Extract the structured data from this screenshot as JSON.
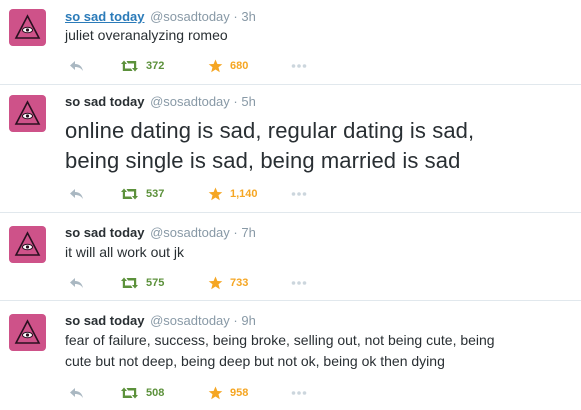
{
  "colors": {
    "name_link": "#2b7bb9",
    "muted": "#8899a6",
    "retweet_green": "#5c913b",
    "favorite_gold": "#f5a623",
    "divider": "#e1e8ed",
    "avatar_pink": "#d6588f"
  },
  "icons": {
    "reply": "reply-arrow-icon",
    "retweet": "retweet-icon",
    "favorite": "star-icon",
    "more": "ellipsis-icon",
    "avatar": "eye-in-triangle-icon"
  },
  "tweets": [
    {
      "name": "so sad today",
      "handle": "@sosadtoday",
      "dot": "·",
      "time": "3h",
      "text": "juliet overanalyzing romeo",
      "retweets": "372",
      "favorites": "680"
    },
    {
      "name": "so sad today",
      "handle": "@sosadtoday",
      "dot": "·",
      "time": "5h",
      "text_line1": "online dating is sad, regular dating is sad,",
      "text_line2": "being single is sad, being married is sad",
      "retweets": "537",
      "favorites": "1,140"
    },
    {
      "name": "so sad today",
      "handle": "@sosadtoday",
      "dot": "·",
      "time": "7h",
      "text": "it will all work out jk",
      "retweets": "575",
      "favorites": "733"
    },
    {
      "name": "so sad today",
      "handle": "@sosadtoday",
      "dot": "·",
      "time": "9h",
      "text_line1": "fear of failure, success, being broke, selling out, not being cute, being",
      "text_line2": "cute but not deep, being deep but not ok, being ok then dying",
      "retweets": "508",
      "favorites": "958"
    }
  ]
}
